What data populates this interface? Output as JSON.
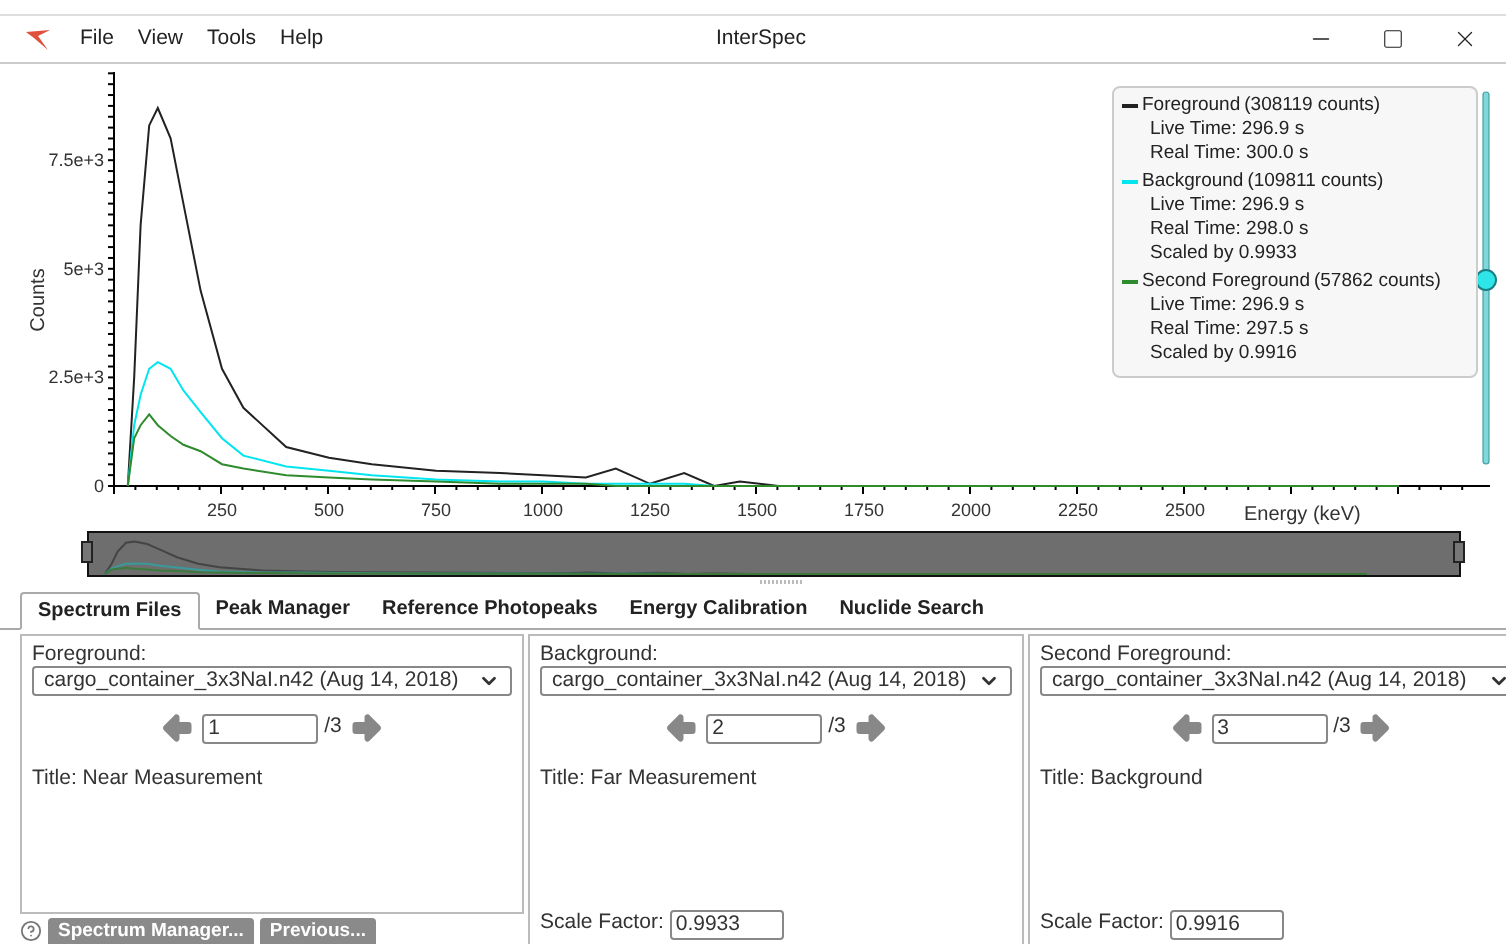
{
  "window": {
    "title": "InterSpec",
    "menu": [
      "File",
      "View",
      "Tools",
      "Help"
    ]
  },
  "spectrum": {
    "chart_data": {
      "type": "line",
      "xlabel": "Energy (keV)",
      "ylabel": "Counts",
      "x": [
        30,
        45,
        60,
        80,
        100,
        130,
        160,
        200,
        250,
        300,
        400,
        500,
        600,
        750,
        900,
        1000,
        1100,
        1170,
        1250,
        1330,
        1400,
        1460,
        1550,
        1750,
        2000,
        2500,
        3000
      ],
      "series": [
        {
          "name": "Foreground",
          "color": "#222222",
          "values": [
            0,
            2500,
            6000,
            8300,
            8700,
            8000,
            6500,
            4500,
            2700,
            1800,
            900,
            650,
            500,
            350,
            300,
            250,
            200,
            400,
            50,
            300,
            0,
            100,
            0,
            0,
            0,
            0,
            0
          ]
        },
        {
          "name": "Background",
          "color": "#00e5ee",
          "values": [
            0,
            1400,
            2100,
            2700,
            2850,
            2700,
            2200,
            1700,
            1100,
            700,
            450,
            350,
            250,
            150,
            100,
            100,
            50,
            50,
            50,
            50,
            0,
            0,
            0,
            null,
            null,
            null,
            null
          ]
        },
        {
          "name": "Second Foreground",
          "color": "#2e8b2e",
          "values": [
            0,
            1100,
            1400,
            1650,
            1400,
            1150,
            950,
            800,
            500,
            400,
            250,
            200,
            150,
            100,
            50,
            50,
            50,
            0,
            0,
            0,
            0,
            0,
            0,
            0,
            0,
            0,
            0
          ]
        }
      ],
      "xlim": [
        0,
        3200
      ],
      "ylim": [
        0,
        9600
      ],
      "xticks": [
        250,
        500,
        750,
        1000,
        1250,
        1500,
        1750,
        2000,
        2250,
        2500
      ],
      "yticks": [
        {
          "value": 0,
          "label": "0"
        },
        {
          "value": 2500,
          "label": "2.5e+3"
        },
        {
          "value": 5000,
          "label": "5e+3"
        },
        {
          "value": 7500,
          "label": "7.5e+3"
        }
      ]
    },
    "legend": [
      {
        "counts": "(308119 counts)",
        "details": [
          "Live Time: 296.9 s",
          "Real Time: 300.0 s"
        ]
      },
      {
        "counts": "(109811 counts)",
        "details": [
          "Live Time: 296.9 s",
          "Real Time: 298.0 s",
          "Scaled by 0.9933"
        ]
      },
      {
        "counts": "(57862 counts)",
        "details": [
          "Live Time: 296.9 s",
          "Real Time: 297.5 s",
          "Scaled by 0.9916"
        ]
      }
    ],
    "y_scale_slider": {
      "level": 0.5
    }
  },
  "tabs": [
    {
      "label": "Spectrum Files",
      "selected": true
    },
    {
      "label": "Peak Manager",
      "selected": false
    },
    {
      "label": "Reference Photopeaks",
      "selected": false
    },
    {
      "label": "Energy Calibration",
      "selected": false
    },
    {
      "label": "Nuclide Search",
      "selected": false
    }
  ],
  "panels": [
    {
      "label": "Foreground:",
      "file": "cargo_container_3x3NaI.n42 (Aug 14, 2018)",
      "index": "1",
      "total": "/3",
      "title": "Title: Near Measurement"
    },
    {
      "label": "Background:",
      "file": "cargo_container_3x3NaI.n42 (Aug 14, 2018)",
      "index": "2",
      "total": "/3",
      "title": "Title: Far Measurement",
      "scale_label": "Scale Factor:",
      "scale_value": "0.9933"
    },
    {
      "label": "Second Foreground:",
      "file": "cargo_container_3x3NaI.n42 (Aug 14, 2018)",
      "index": "3",
      "total": "/3",
      "title": "Title: Background",
      "scale_label": "Scale Factor:",
      "scale_value": "0.9916"
    }
  ],
  "footer_buttons": [
    "Spectrum Manager...",
    "Previous..."
  ]
}
